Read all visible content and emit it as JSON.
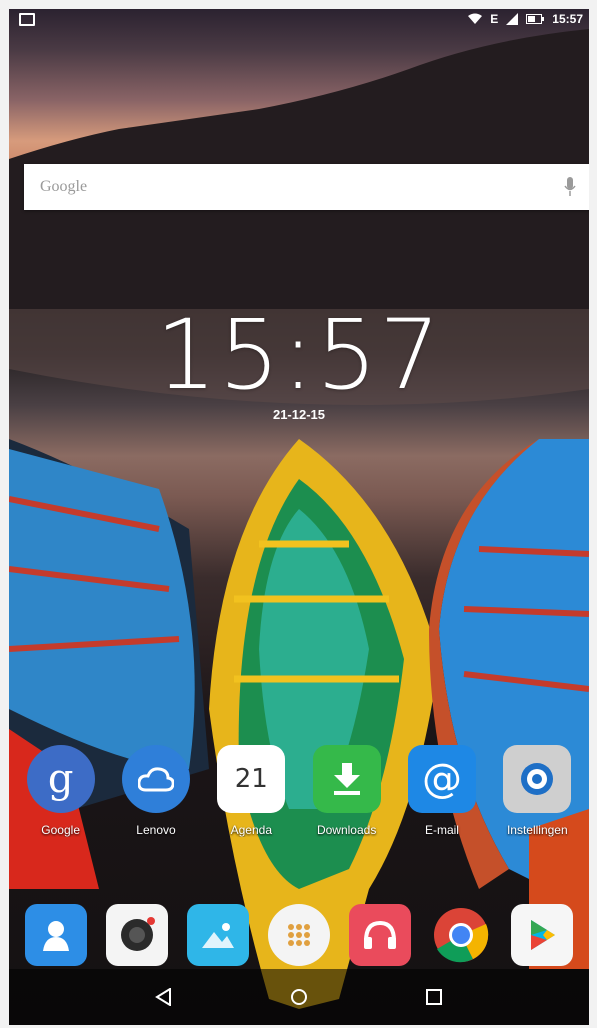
{
  "status_bar": {
    "network": "E",
    "time": "15:57"
  },
  "search": {
    "placeholder": "Google"
  },
  "clock": {
    "time": "15:57",
    "date": "21-12-15"
  },
  "apps": [
    {
      "label": "Google",
      "icon": "google-g-icon"
    },
    {
      "label": "Lenovo",
      "icon": "lenovo-cloud-icon"
    },
    {
      "label": "Agenda",
      "icon": "calendar-icon",
      "day": "21"
    },
    {
      "label": "Downloads",
      "icon": "download-icon"
    },
    {
      "label": "E-mail",
      "icon": "email-at-icon"
    },
    {
      "label": "Instellingen",
      "icon": "settings-icon"
    }
  ],
  "dock": [
    {
      "icon": "contacts-icon"
    },
    {
      "icon": "camera-icon"
    },
    {
      "icon": "gallery-icon"
    },
    {
      "icon": "app-drawer-icon"
    },
    {
      "icon": "music-headphones-icon"
    },
    {
      "icon": "chrome-icon"
    },
    {
      "icon": "play-store-icon"
    }
  ],
  "nav": [
    "back-icon",
    "home-icon",
    "recents-icon"
  ],
  "colors": {
    "google": "#3d6cc6",
    "lenovo": "#2f7fd9",
    "downloads": "#35b94a",
    "email": "#1e88e5",
    "settings": "#cfcfcf",
    "music": "#ea4b5c"
  }
}
